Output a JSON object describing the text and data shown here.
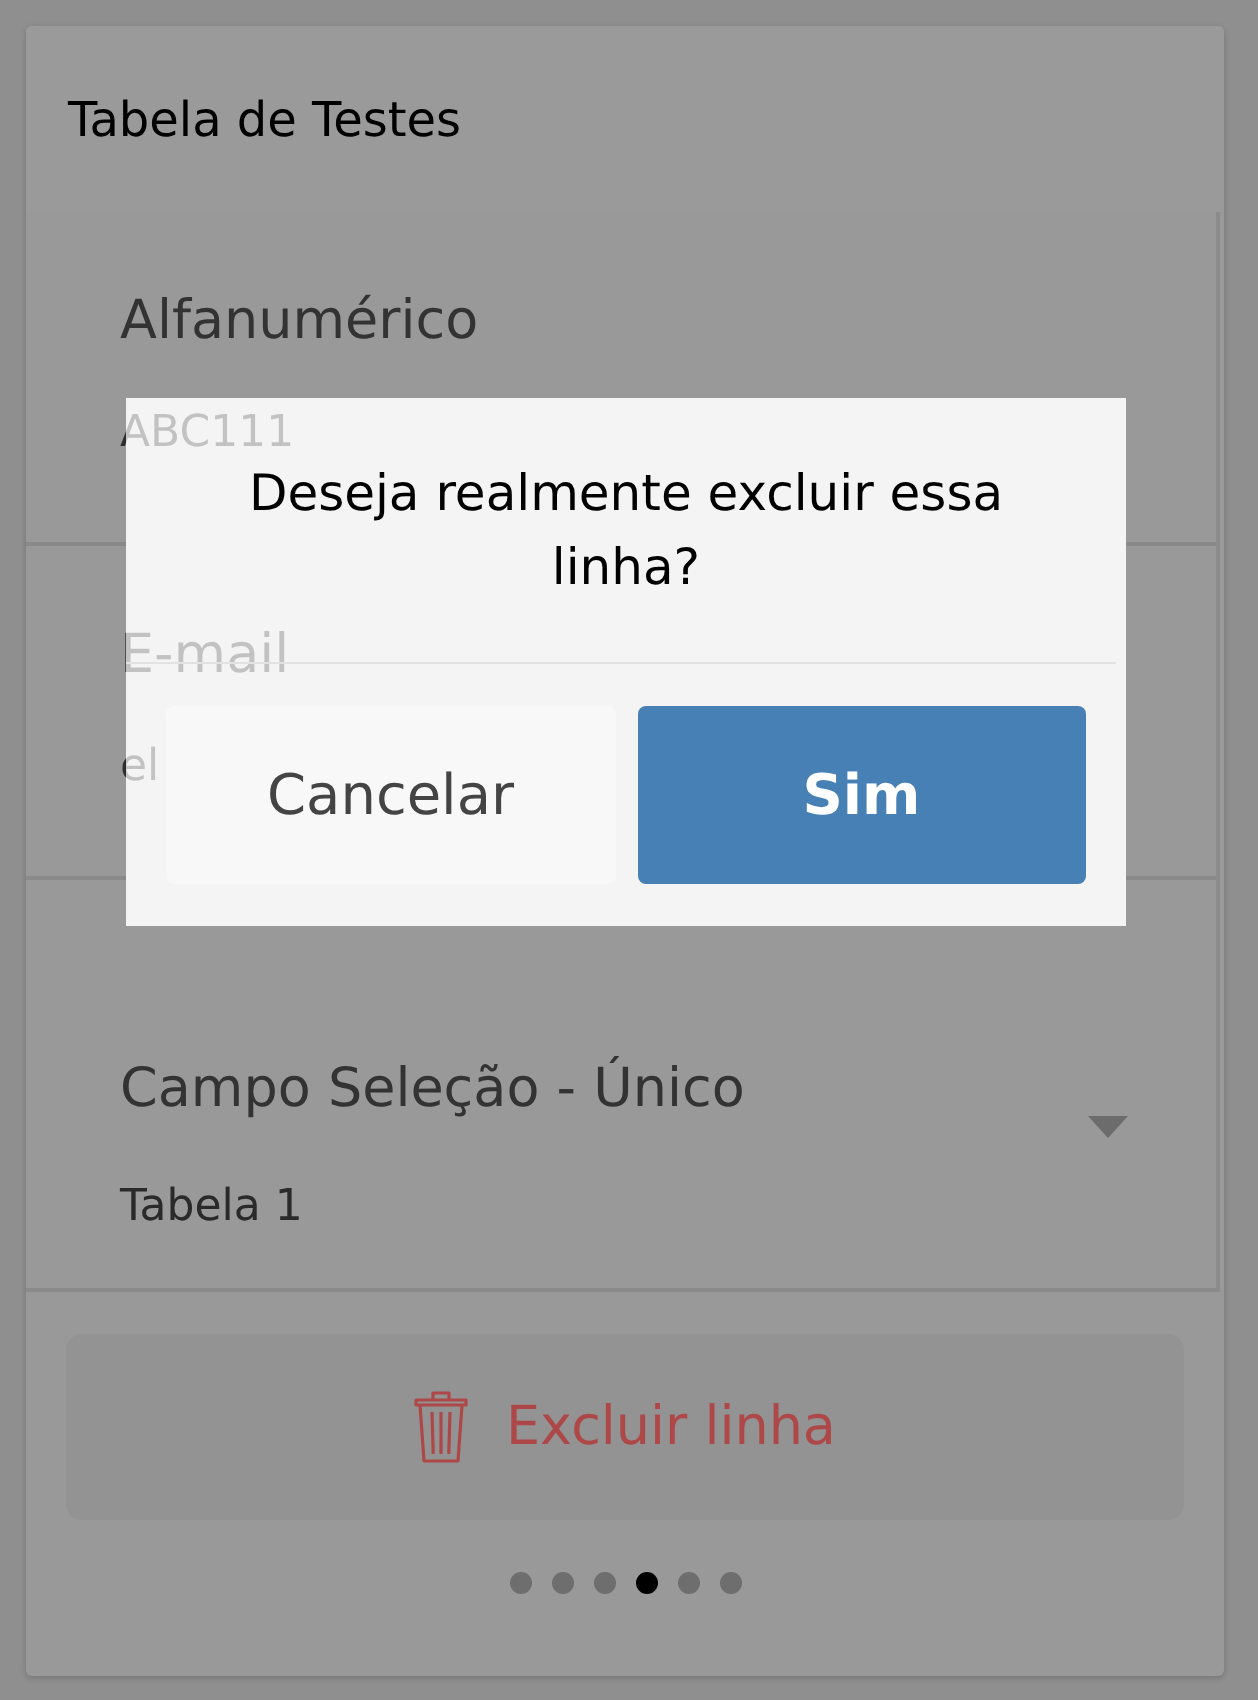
{
  "card": {
    "title": "Tabela de Testes",
    "fields": [
      {
        "kind": "text",
        "label": "Alfanumérico",
        "value": "ABC111"
      },
      {
        "kind": "text",
        "label": "E-mail",
        "value": "el"
      },
      {
        "kind": "select",
        "label": "Campo Seleção - Único",
        "value": "Tabela 1"
      }
    ],
    "delete_button": {
      "label": "Excluir linha"
    },
    "pager": [
      {
        "selected": false
      },
      {
        "selected": false
      },
      {
        "selected": false
      },
      {
        "selected": true
      },
      {
        "selected": false
      },
      {
        "selected": false
      }
    ]
  },
  "dialog": {
    "message": "Deseja realmente excluir essa linha?",
    "buttons": [
      {
        "kind": "secondary",
        "label": "Cancelar"
      },
      {
        "kind": "primary",
        "label": "Sim"
      }
    ]
  }
}
